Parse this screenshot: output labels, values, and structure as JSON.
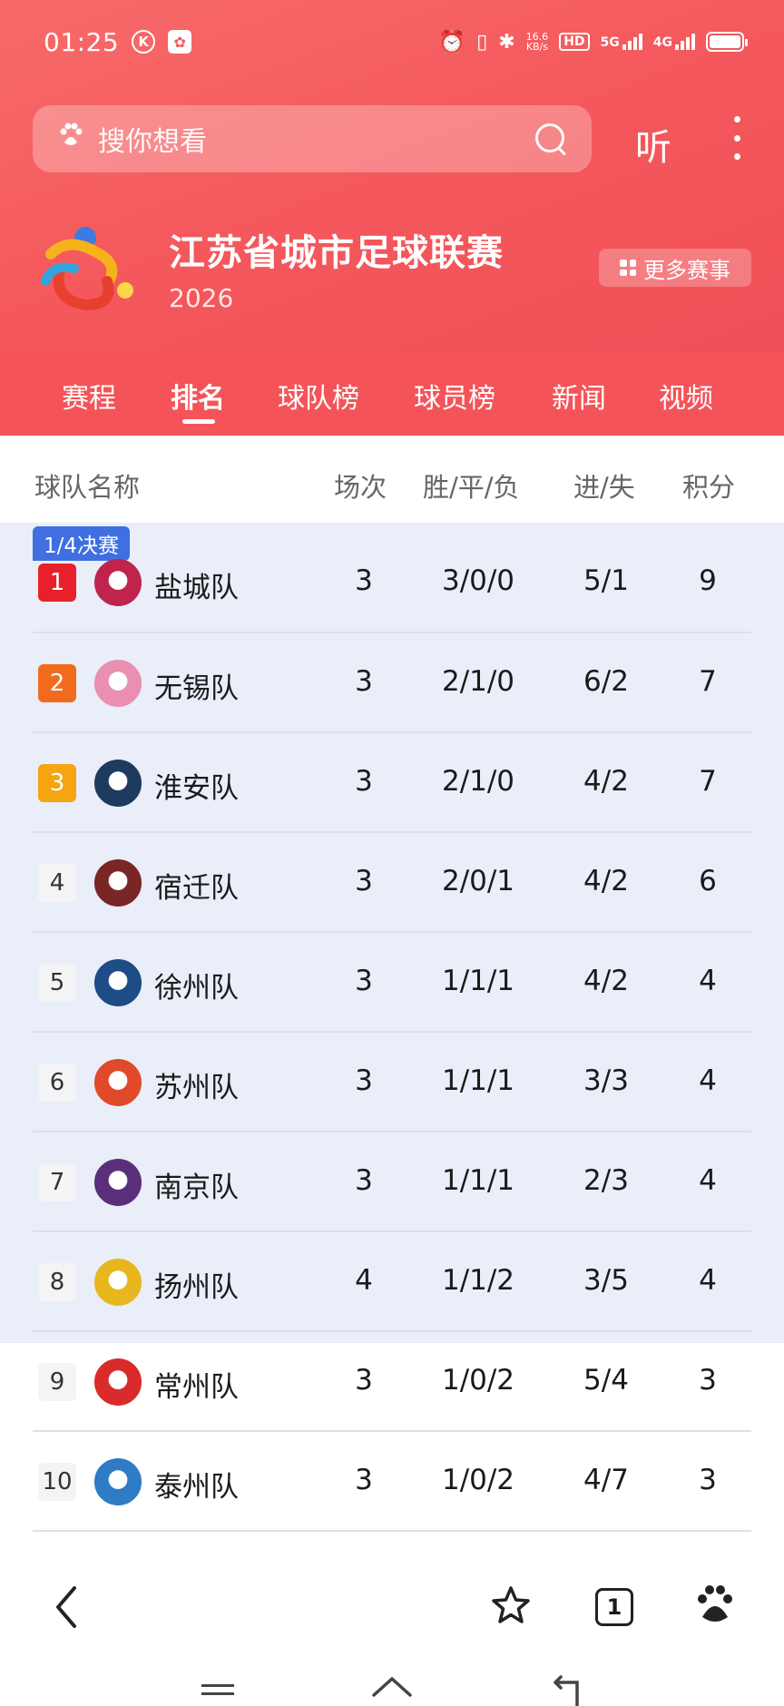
{
  "status_bar": {
    "time": "01:25",
    "network_speed_top": "16.6",
    "network_speed_bottom": "KB/s",
    "hd": "HD",
    "sim1": "5G",
    "sim2": "4G"
  },
  "search": {
    "placeholder": "搜你想看",
    "listen_label": "听"
  },
  "league": {
    "title": "江苏省城市足球联赛",
    "year": "2026",
    "more_label": "更多赛事"
  },
  "tabs": [
    {
      "label": "赛程"
    },
    {
      "label": "排名"
    },
    {
      "label": "球队榜"
    },
    {
      "label": "球员榜"
    },
    {
      "label": "新闻"
    },
    {
      "label": "视频"
    }
  ],
  "active_tab": "排名",
  "table": {
    "headers": {
      "team": "球队名称",
      "played": "场次",
      "wdl": "胜/平/负",
      "goals": "进/失",
      "points": "积分"
    },
    "qualification_label": "1/4决赛",
    "rows": [
      {
        "rank": "1",
        "team": "盐城队",
        "played": "3",
        "wdl": "3/0/0",
        "goals": "5/1",
        "points": "9"
      },
      {
        "rank": "2",
        "team": "无锡队",
        "played": "3",
        "wdl": "2/1/0",
        "goals": "6/2",
        "points": "7"
      },
      {
        "rank": "3",
        "team": "淮安队",
        "played": "3",
        "wdl": "2/1/0",
        "goals": "4/2",
        "points": "7"
      },
      {
        "rank": "4",
        "team": "宿迁队",
        "played": "3",
        "wdl": "2/0/1",
        "goals": "4/2",
        "points": "6"
      },
      {
        "rank": "5",
        "team": "徐州队",
        "played": "3",
        "wdl": "1/1/1",
        "goals": "4/2",
        "points": "4"
      },
      {
        "rank": "6",
        "team": "苏州队",
        "played": "3",
        "wdl": "1/1/1",
        "goals": "3/3",
        "points": "4"
      },
      {
        "rank": "7",
        "team": "南京队",
        "played": "3",
        "wdl": "1/1/1",
        "goals": "2/3",
        "points": "4"
      },
      {
        "rank": "8",
        "team": "扬州队",
        "played": "4",
        "wdl": "1/1/2",
        "goals": "3/5",
        "points": "4"
      },
      {
        "rank": "9",
        "team": "常州队",
        "played": "3",
        "wdl": "1/0/2",
        "goals": "5/4",
        "points": "3"
      },
      {
        "rank": "10",
        "team": "泰州队",
        "played": "3",
        "wdl": "1/0/2",
        "goals": "4/7",
        "points": "3"
      }
    ]
  },
  "rank_colors": {
    "1": "#e8202a",
    "2": "#f26b1d",
    "3": "#f5a511"
  },
  "team_logo_colors": [
    "#c0234b",
    "#e98fb2",
    "#1f3a5f",
    "#7a2626",
    "#1d4c86",
    "#e04a2a",
    "#5b2e7a",
    "#e7b71d",
    "#d92b2b",
    "#2f7bc4"
  ],
  "bottom_nav": {
    "tab_count": "1",
    "icons": [
      "back-icon",
      "star-icon",
      "tabs-icon",
      "paw-icon"
    ]
  },
  "colors": {
    "brand_red": "#f45459",
    "qual_bg": "#e9eef9",
    "qual_badge": "#3f6fe0"
  }
}
